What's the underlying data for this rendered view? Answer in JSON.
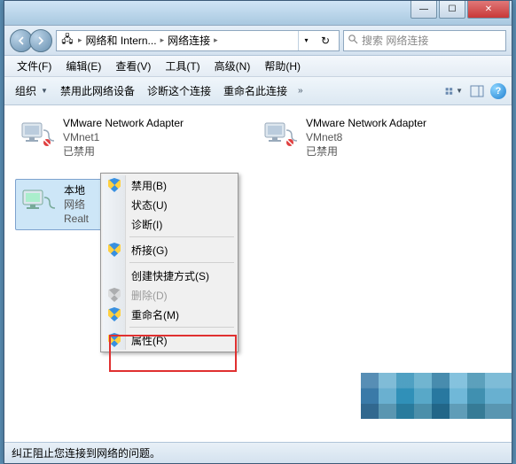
{
  "titlebar": {
    "min": "—",
    "max": "☐",
    "close": "✕"
  },
  "addressbar": {
    "icon": "🖧",
    "crumb1": "网络和 Intern...",
    "crumb2": "网络连接",
    "refresh": "↻",
    "search_placeholder": "搜索 网络连接"
  },
  "menubar": {
    "file": "文件(F)",
    "edit": "编辑(E)",
    "view": "查看(V)",
    "tools": "工具(T)",
    "advanced": "高级(N)",
    "help": "帮助(H)"
  },
  "toolbar": {
    "organize": "组织",
    "disable_device": "禁用此网络设备",
    "diagnose": "诊断这个连接",
    "rename": "重命名此连接",
    "help_glyph": "?"
  },
  "adapters": [
    {
      "name": "VMware Network Adapter",
      "sub": "VMnet1",
      "status": "已禁用"
    },
    {
      "name": "VMware Network Adapter",
      "sub": "VMnet8",
      "status": "已禁用"
    }
  ],
  "local": {
    "name_prefix": "本地",
    "sub_prefix": "网络",
    "detail_prefix": "Realt"
  },
  "context_menu": {
    "disable": "禁用(B)",
    "status": "状态(U)",
    "diagnose": "诊断(I)",
    "bridge": "桥接(G)",
    "shortcut": "创建快捷方式(S)",
    "delete": "删除(D)",
    "rename": "重命名(M)",
    "properties": "属性(R)"
  },
  "statusbar": {
    "text": "纠正阻止您连接到网络的问题。"
  }
}
